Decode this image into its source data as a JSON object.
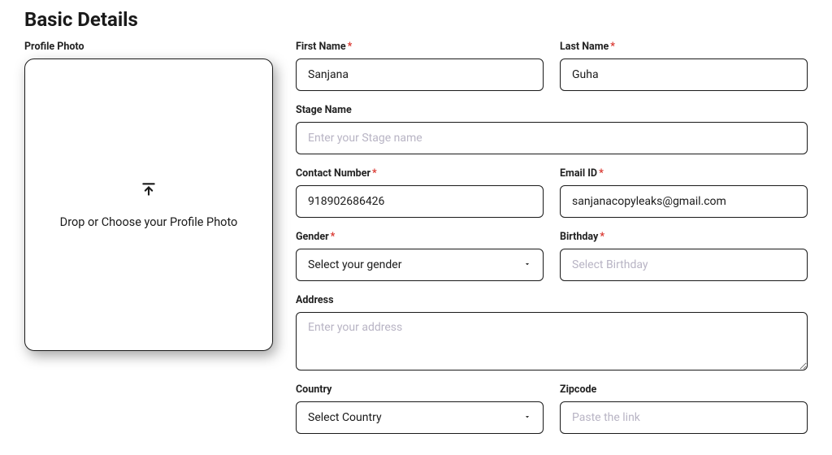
{
  "heading": "Basic Details",
  "profilePhoto": {
    "label": "Profile Photo",
    "dropText": "Drop or Choose your Profile Photo"
  },
  "firstName": {
    "label": "First Name",
    "value": "Sanjana"
  },
  "lastName": {
    "label": "Last Name",
    "value": "Guha"
  },
  "stageName": {
    "label": "Stage Name",
    "placeholder": "Enter your Stage name",
    "value": ""
  },
  "contactNumber": {
    "label": "Contact Number",
    "value": "918902686426"
  },
  "emailId": {
    "label": "Email ID",
    "value": "sanjanacopyleaks@gmail.com"
  },
  "gender": {
    "label": "Gender",
    "selected": "Select your gender"
  },
  "birthday": {
    "label": "Birthday",
    "placeholder": "Select Birthday",
    "value": ""
  },
  "address": {
    "label": "Address",
    "placeholder": "Enter your address",
    "value": ""
  },
  "country": {
    "label": "Country",
    "selected": "Select Country"
  },
  "zipcode": {
    "label": "Zipcode",
    "placeholder": "Paste the link",
    "value": ""
  }
}
